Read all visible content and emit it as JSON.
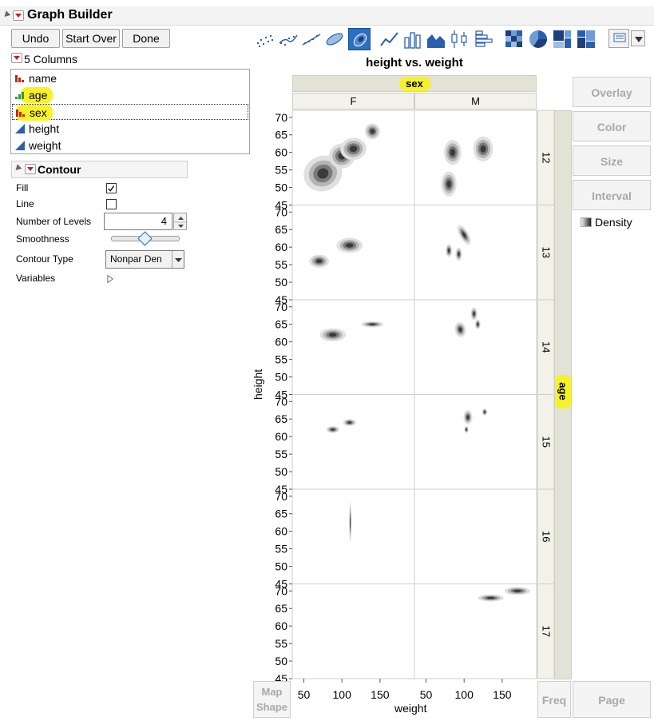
{
  "app": {
    "title": "Graph Builder"
  },
  "toolbar": {
    "undo": "Undo",
    "start_over": "Start Over",
    "done": "Done"
  },
  "columns": {
    "count_label": "5 Columns",
    "items": [
      {
        "name": "name",
        "type": "nominal"
      },
      {
        "name": "age",
        "type": "ordinal"
      },
      {
        "name": "sex",
        "type": "nominal"
      },
      {
        "name": "height",
        "type": "continuous"
      },
      {
        "name": "weight",
        "type": "continuous"
      }
    ]
  },
  "contour": {
    "title": "Contour",
    "fill_label": "Fill",
    "fill_checked": true,
    "line_label": "Line",
    "line_checked": false,
    "levels_label": "Number of Levels",
    "levels_value": "4",
    "smoothness_label": "Smoothness",
    "smoothness_value": 0.5,
    "type_label": "Contour Type",
    "type_value": "Nonpar Den",
    "variables_label": "Variables"
  },
  "graph": {
    "title": "height vs. weight",
    "group_x_title": "sex",
    "group_x_levels": [
      "F",
      "M"
    ],
    "group_y_title": "age",
    "group_y_levels": [
      "12",
      "13",
      "14",
      "15",
      "16",
      "17"
    ],
    "x_label": "weight",
    "y_label": "height",
    "x_ticks": [
      "50",
      "100",
      "150"
    ],
    "y_ticks": [
      "70",
      "65",
      "60",
      "55",
      "50",
      "45"
    ]
  },
  "right_buttons": {
    "overlay": "Overlay",
    "color": "Color",
    "size": "Size",
    "interval": "Interval"
  },
  "legend": {
    "label": "Density"
  },
  "bottom_buttons": {
    "map_shape": [
      "Map",
      "Shape"
    ],
    "freq": "Freq",
    "page": "Page"
  },
  "colors": {
    "dark": "#3a3a3a",
    "mid": "#7a7a7a",
    "light": "#b5b5b5",
    "pale": "#e0e0e0",
    "highlight": "#f6f22a",
    "toolbar_selected": "#2a6fc1"
  },
  "chart_data": {
    "type": "contour",
    "x_axis": "weight",
    "y_axis": "height",
    "xlim": [
      40,
      190
    ],
    "ylim": [
      45,
      72
    ],
    "panels": [
      {
        "sex": "F",
        "age": "12",
        "blobs": [
          {
            "x": 75,
            "y": 54,
            "sx": 18,
            "sy": 3.5,
            "ang": 25
          },
          {
            "x": 100,
            "y": 59,
            "sx": 12,
            "sy": 2.5,
            "ang": 15
          },
          {
            "x": 115,
            "y": 61,
            "sx": 12,
            "sy": 2.2,
            "ang": 5
          },
          {
            "x": 140,
            "y": 66,
            "sx": 7,
            "sy": 1.6,
            "ang": 10
          }
        ]
      },
      {
        "sex": "M",
        "age": "12",
        "blobs": [
          {
            "x": 85,
            "y": 60,
            "sx": 8,
            "sy": 2.5,
            "ang": 0
          },
          {
            "x": 125,
            "y": 61,
            "sx": 9,
            "sy": 2.5,
            "ang": 0
          },
          {
            "x": 80,
            "y": 51,
            "sx": 7,
            "sy": 2.5,
            "ang": 0
          }
        ]
      },
      {
        "sex": "F",
        "age": "13",
        "blobs": [
          {
            "x": 70,
            "y": 56,
            "sx": 9,
            "sy": 1.3,
            "ang": 0
          },
          {
            "x": 110,
            "y": 60.5,
            "sx": 12,
            "sy": 1.5,
            "ang": 0
          }
        ]
      },
      {
        "sex": "M",
        "age": "13",
        "blobs": [
          {
            "x": 100,
            "y": 63.5,
            "sx": 4,
            "sy": 2.2,
            "ang": 30
          },
          {
            "x": 80,
            "y": 59,
            "sx": 3,
            "sy": 1.3,
            "ang": 0
          },
          {
            "x": 93,
            "y": 58,
            "sx": 3,
            "sy": 1.3,
            "ang": 0
          }
        ]
      },
      {
        "sex": "F",
        "age": "14",
        "blobs": [
          {
            "x": 88,
            "y": 62,
            "sx": 12,
            "sy": 1.3,
            "ang": 0
          },
          {
            "x": 140,
            "y": 65,
            "sx": 10,
            "sy": 0.6,
            "ang": 0
          }
        ]
      },
      {
        "sex": "M",
        "age": "14",
        "blobs": [
          {
            "x": 95,
            "y": 63.5,
            "sx": 5,
            "sy": 1.5,
            "ang": 10
          },
          {
            "x": 113,
            "y": 68,
            "sx": 3,
            "sy": 1.3,
            "ang": 0
          },
          {
            "x": 118,
            "y": 65,
            "sx": 2.5,
            "sy": 1.0,
            "ang": 0
          }
        ]
      },
      {
        "sex": "F",
        "age": "15",
        "blobs": [
          {
            "x": 88,
            "y": 62,
            "sx": 6,
            "sy": 0.7,
            "ang": 0
          },
          {
            "x": 110,
            "y": 64,
            "sx": 6,
            "sy": 0.7,
            "ang": 0
          }
        ]
      },
      {
        "sex": "M",
        "age": "15",
        "blobs": [
          {
            "x": 105,
            "y": 65.5,
            "sx": 4,
            "sy": 1.4,
            "ang": 0
          },
          {
            "x": 127,
            "y": 67,
            "sx": 2.5,
            "sy": 0.7,
            "ang": 0
          },
          {
            "x": 103,
            "y": 62,
            "sx": 2,
            "sy": 0.7,
            "ang": 0
          }
        ]
      },
      {
        "sex": "F",
        "age": "16",
        "blobs": [
          {
            "x": 111,
            "y": 62.5,
            "sx": 1.0,
            "sy": 4,
            "ang": 0
          }
        ]
      },
      {
        "sex": "M",
        "age": "16",
        "blobs": []
      },
      {
        "sex": "F",
        "age": "17",
        "blobs": []
      },
      {
        "sex": "M",
        "age": "17",
        "blobs": [
          {
            "x": 135,
            "y": 68,
            "sx": 12,
            "sy": 0.7,
            "ang": 0
          },
          {
            "x": 170,
            "y": 70,
            "sx": 12,
            "sy": 0.8,
            "ang": 0
          }
        ]
      }
    ]
  }
}
